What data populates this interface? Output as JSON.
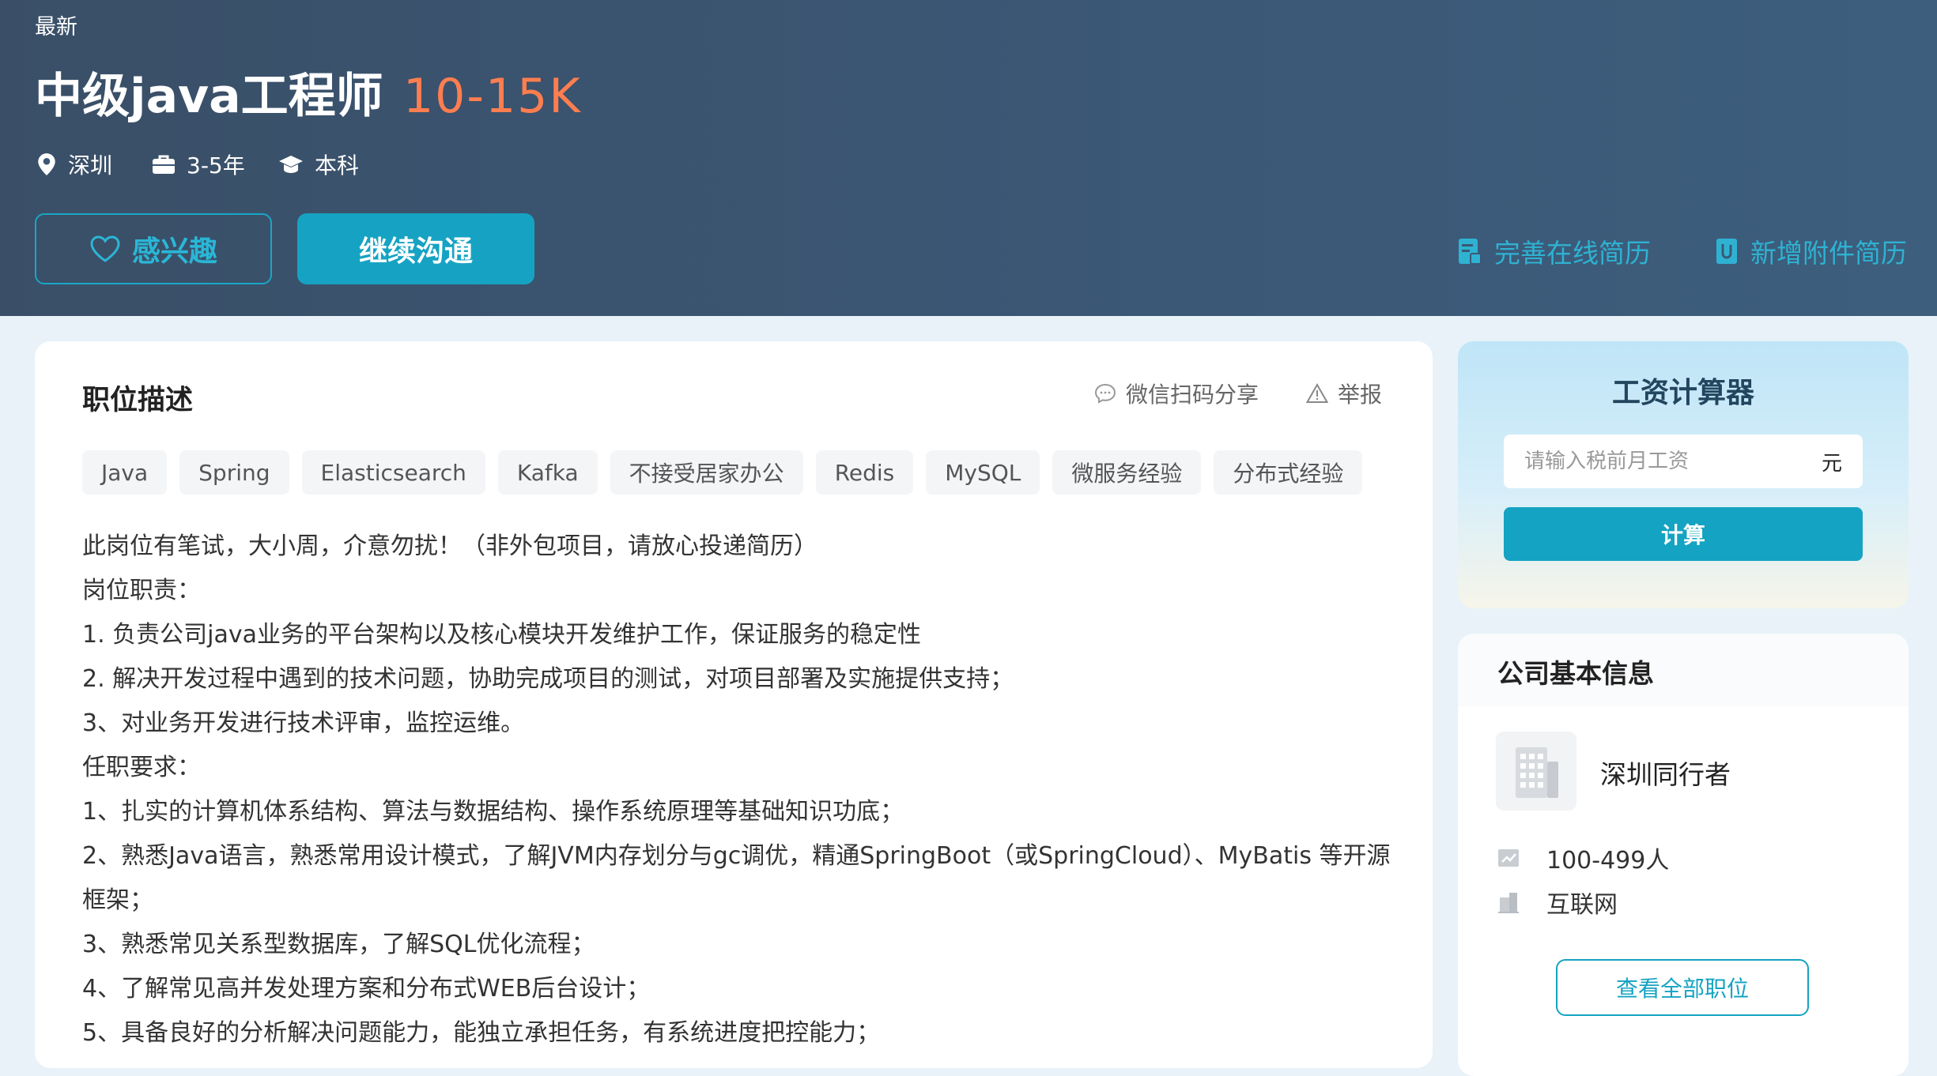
{
  "header": {
    "latest_label": "最新",
    "job_title": "中级java工程师",
    "salary": "10-15K",
    "city": "深圳",
    "experience": "3-5年",
    "education": "本科",
    "interest_label": "感兴趣",
    "chat_label": "继续沟通",
    "resume_online_label": "完善在线简历",
    "resume_attach_label": "新增附件简历"
  },
  "description": {
    "title": "职位描述",
    "share_label": "微信扫码分享",
    "report_label": "举报",
    "tags": [
      "Java",
      "Spring",
      "Elasticsearch",
      "Kafka",
      "不接受居家办公",
      "Redis",
      "MySQL",
      "微服务经验",
      "分布式经验"
    ],
    "lines": [
      "此岗位有笔试，大小周，介意勿扰！（非外包项目，请放心投递简历）",
      "岗位职责：",
      "1. 负责公司java业务的平台架构以及核心模块开发维护工作，保证服务的稳定性",
      "2. 解决开发过程中遇到的技术问题，协助完成项目的测试，对项目部署及实施提供支持；",
      "3、对业务开发进行技术评审，监控运维。",
      "任职要求：",
      "1、扎实的计算机体系结构、算法与数据结构、操作系统原理等基础知识功底；",
      "2、熟悉Java语言，熟悉常用设计模式，了解JVM内存划分与gc调优，精通SpringBoot（或SpringCloud）、MyBatis 等开源框架；",
      "3、熟悉常见关系型数据库，了解SQL优化流程；",
      "4、了解常见高并发处理方案和分布式WEB后台设计；",
      "5、具备良好的分析解决问题能力，能独立承担任务，有系统进度把控能力；"
    ]
  },
  "calculator": {
    "title": "工资计算器",
    "input_placeholder": "请输入税前月工资",
    "unit": "元",
    "button_label": "计算"
  },
  "company": {
    "section_title": "公司基本信息",
    "name": "深圳同行者",
    "size": "100-499人",
    "industry": "互联网",
    "all_jobs_label": "查看全部职位"
  },
  "colors": {
    "header_bg": "#3b5775",
    "accent": "#14a3c2",
    "salary": "#ff7e4f",
    "page_bg": "#e8f2f8"
  }
}
